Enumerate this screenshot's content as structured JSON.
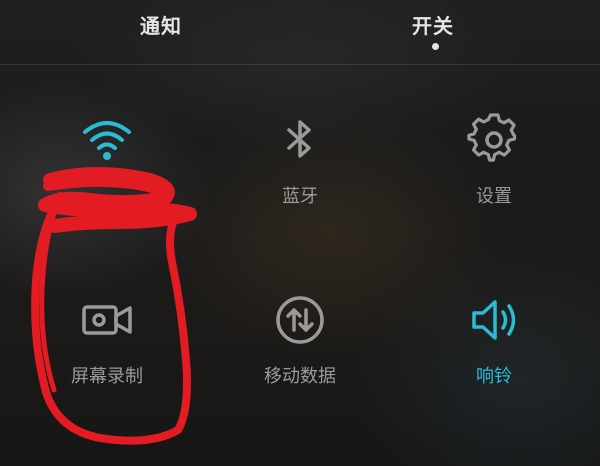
{
  "tabs": {
    "notifications": "通知",
    "switches": "开关"
  },
  "toggles": {
    "wifi": {
      "label": "",
      "icon": "wifi-icon",
      "active": true
    },
    "bluetooth": {
      "label": "蓝牙",
      "icon": "bluetooth-icon",
      "active": false
    },
    "settings": {
      "label": "设置",
      "icon": "gear-icon",
      "active": false
    },
    "screen_record": {
      "label": "屏幕录制",
      "icon": "video-camera-icon",
      "active": false
    },
    "mobile_data": {
      "label": "移动数据",
      "icon": "data-transfer-icon",
      "active": false
    },
    "ring": {
      "label": "响铃",
      "icon": "speaker-icon",
      "active": true
    }
  },
  "colors": {
    "accent": "#2bbcd4",
    "icon_inactive": "#9a9a9a",
    "annotation": "#e31b23"
  }
}
